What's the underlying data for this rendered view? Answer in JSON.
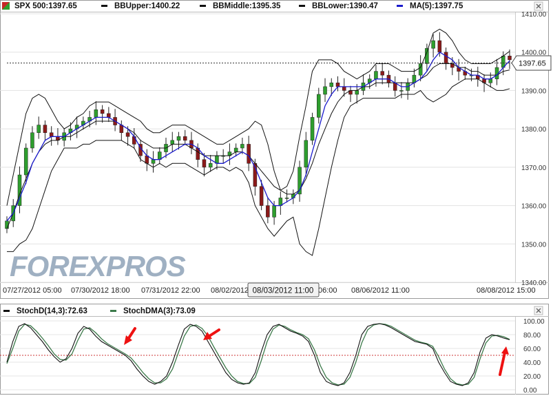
{
  "legend": {
    "spx": "SPX 500:1397.65",
    "bbupper": "BBUpper:1400.22",
    "bbmiddle": "BBMiddle:1395.35",
    "bblower": "BBLower:1390.47",
    "ma5": "MA(5):1397.75",
    "stochd": "StochD(14,3):72.63",
    "stochdma": "StochDMA(3):73.09"
  },
  "watermark": "FOREXPROS",
  "price_label": "1397.65",
  "crosshair_date": "08/03/2012 11:00",
  "colors": {
    "up_candle": "#2e9e2e",
    "down_candle": "#8b1a1a",
    "ma_line": "#1a1acc",
    "band_line": "#111111",
    "stoch_d": "#111111",
    "stoch_dma": "#3c7a4a",
    "arrow": "#ee1111",
    "watermark": "#8fa3b8",
    "oversold_line": "#cc3333"
  },
  "icons": [
    "close-icon",
    "close-icon",
    "red-arrow-icon",
    "red-arrow-icon",
    "red-arrow-icon"
  ],
  "chart_data": [
    {
      "type": "candlestick",
      "title": "",
      "ylim": [
        1340,
        1410
      ],
      "yticks": [
        "1340.00",
        "1350.00",
        "1360.00",
        "1370.00",
        "1380.00",
        "1390.00",
        "1400.00",
        "1410.00"
      ],
      "xticks": [
        "07/27/2012 05:00",
        "07/30/2012 18:00",
        "07/31/2012 22:00",
        "08/02/2012",
        "06:00",
        "08/06/2012 11:00",
        "08/08/2012 15:00"
      ],
      "last_price": 1397.65,
      "series": [
        {
          "name": "SPX 500",
          "kind": "close",
          "values": [
            1356,
            1360,
            1368,
            1375,
            1379,
            1381,
            1379,
            1378,
            1377,
            1379,
            1380,
            1381,
            1382,
            1383,
            1385,
            1384,
            1383,
            1381,
            1379,
            1378,
            1376,
            1373,
            1371,
            1372,
            1374,
            1376,
            1377,
            1378,
            1377,
            1375,
            1372,
            1370,
            1371,
            1373,
            1373,
            1374,
            1375,
            1376,
            1371,
            1365,
            1360,
            1357,
            1360,
            1362,
            1362,
            1363,
            1370,
            1377,
            1383,
            1389,
            1391,
            1392,
            1391,
            1390,
            1389,
            1390,
            1392,
            1393,
            1395,
            1394,
            1392,
            1390,
            1390,
            1392,
            1394,
            1397,
            1401,
            1403,
            1400,
            1397,
            1396,
            1395,
            1394,
            1394,
            1393,
            1392,
            1393,
            1396,
            1399,
            1398
          ]
        },
        {
          "name": "MA(5)",
          "values": [
            1356,
            1358,
            1362,
            1366,
            1371,
            1374,
            1377,
            1378,
            1378,
            1378,
            1379,
            1380,
            1381,
            1382,
            1383,
            1383,
            1383,
            1382,
            1381,
            1380,
            1378,
            1375,
            1373,
            1372,
            1372,
            1373,
            1374,
            1375,
            1376,
            1376,
            1375,
            1373,
            1372,
            1371,
            1371,
            1372,
            1373,
            1374,
            1373,
            1370,
            1366,
            1362,
            1360,
            1360,
            1361,
            1362,
            1364,
            1368,
            1374,
            1380,
            1386,
            1389,
            1391,
            1391,
            1391,
            1391,
            1391,
            1392,
            1393,
            1393,
            1393,
            1392,
            1391,
            1391,
            1392,
            1393,
            1395,
            1398,
            1400,
            1399,
            1398,
            1396,
            1395,
            1394,
            1394,
            1393,
            1393,
            1394,
            1396,
            1397.75
          ]
        },
        {
          "name": "BBUpper",
          "values": [
            1360,
            1368,
            1376,
            1384,
            1388,
            1389,
            1388,
            1385,
            1382,
            1380,
            1381,
            1383,
            1384,
            1386,
            1387,
            1387,
            1387,
            1386,
            1385,
            1384,
            1383,
            1382,
            1380,
            1379,
            1379,
            1380,
            1381,
            1381,
            1381,
            1380,
            1379,
            1378,
            1377,
            1376,
            1376,
            1377,
            1378,
            1379,
            1380,
            1382,
            1381,
            1376,
            1369,
            1364,
            1365,
            1369,
            1378,
            1386,
            1395,
            1398,
            1398,
            1398,
            1397,
            1395,
            1394,
            1393,
            1394,
            1395,
            1397,
            1397,
            1397,
            1396,
            1395,
            1395,
            1395,
            1396,
            1400,
            1405,
            1406,
            1405,
            1403,
            1400,
            1398,
            1397,
            1397,
            1397,
            1397,
            1398,
            1399,
            1400.22
          ]
        },
        {
          "name": "BBMiddle",
          "values": [
            1354,
            1358,
            1363,
            1367,
            1371,
            1374,
            1376,
            1377,
            1377,
            1378,
            1378,
            1379,
            1380,
            1381,
            1382,
            1382,
            1382,
            1382,
            1381,
            1380,
            1379,
            1377,
            1376,
            1375,
            1375,
            1375,
            1376,
            1376,
            1376,
            1375,
            1374,
            1373,
            1373,
            1373,
            1373,
            1373,
            1374,
            1374,
            1373,
            1371,
            1369,
            1367,
            1365,
            1364,
            1363,
            1363,
            1364,
            1367,
            1371,
            1376,
            1380,
            1384,
            1387,
            1389,
            1390,
            1390,
            1391,
            1391,
            1392,
            1392,
            1392,
            1392,
            1392,
            1392,
            1392,
            1393,
            1394,
            1396,
            1397,
            1397,
            1397,
            1396,
            1396,
            1395,
            1395,
            1394,
            1394,
            1394,
            1395,
            1395.35
          ]
        },
        {
          "name": "BBLower",
          "values": [
            1348,
            1348,
            1350,
            1351,
            1354,
            1359,
            1364,
            1369,
            1372,
            1375,
            1375,
            1375,
            1376,
            1376,
            1377,
            1377,
            1377,
            1377,
            1377,
            1376,
            1375,
            1372,
            1371,
            1370,
            1371,
            1370,
            1371,
            1371,
            1371,
            1370,
            1369,
            1368,
            1369,
            1370,
            1370,
            1369,
            1370,
            1369,
            1366,
            1360,
            1357,
            1354,
            1352,
            1354,
            1356,
            1357,
            1350,
            1348,
            1347,
            1354,
            1362,
            1370,
            1377,
            1383,
            1386,
            1387,
            1388,
            1388,
            1388,
            1388,
            1388,
            1388,
            1389,
            1389,
            1389,
            1390,
            1388,
            1387,
            1388,
            1389,
            1391,
            1392,
            1393,
            1393,
            1393,
            1392,
            1391,
            1390,
            1390,
            1390.47
          ]
        }
      ]
    },
    {
      "type": "line",
      "title": "",
      "ylim": [
        0,
        100
      ],
      "yticks": [
        "0.00",
        "20.00",
        "40.00",
        "60.00",
        "80.00",
        "100.00"
      ],
      "reference_line": 50,
      "series": [
        {
          "name": "StochD(14,3)",
          "values": [
            40,
            70,
            92,
            96,
            90,
            80,
            70,
            58,
            48,
            40,
            45,
            60,
            82,
            92,
            88,
            78,
            70,
            65,
            60,
            55,
            50,
            42,
            30,
            20,
            12,
            8,
            12,
            20,
            40,
            65,
            88,
            95,
            92,
            85,
            70,
            55,
            40,
            25,
            15,
            10,
            8,
            10,
            25,
            55,
            80,
            92,
            95,
            90,
            85,
            82,
            78,
            70,
            50,
            25,
            12,
            8,
            6,
            10,
            25,
            50,
            80,
            92,
            95,
            96,
            94,
            90,
            85,
            80,
            75,
            70,
            68,
            66,
            60,
            40,
            25,
            12,
            8,
            6,
            10,
            25,
            55,
            75,
            80,
            78,
            75,
            72.63
          ]
        },
        {
          "name": "StochDMA(3)",
          "values": [
            38,
            60,
            85,
            95,
            93,
            85,
            75,
            64,
            52,
            44,
            43,
            52,
            72,
            88,
            90,
            83,
            74,
            67,
            62,
            57,
            52,
            46,
            36,
            25,
            16,
            10,
            10,
            16,
            30,
            54,
            78,
            92,
            94,
            89,
            78,
            62,
            47,
            32,
            20,
            12,
            9,
            9,
            18,
            42,
            70,
            88,
            94,
            92,
            87,
            83,
            80,
            74,
            58,
            35,
            18,
            10,
            7,
            8,
            18,
            40,
            68,
            87,
            94,
            96,
            95,
            92,
            87,
            82,
            77,
            72,
            69,
            67,
            63,
            48,
            30,
            16,
            9,
            7,
            8,
            18,
            45,
            68,
            78,
            79,
            77,
            73.09
          ]
        }
      ]
    }
  ]
}
